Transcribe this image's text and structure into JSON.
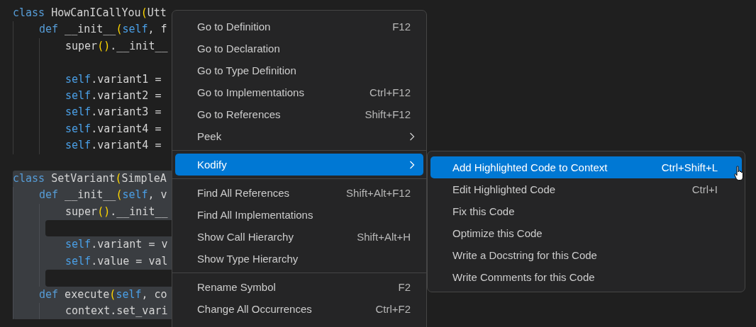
{
  "editor": {
    "blocks": [
      {
        "selected": false,
        "tokens": [
          {
            "text": "class",
            "kind": "keyword"
          },
          {
            "text": " HowCanICallYou",
            "kind": "plain"
          },
          {
            "text": "(",
            "kind": "paren"
          },
          {
            "text": "Utt",
            "kind": "plain"
          }
        ],
        "children": [
          {
            "tokens": [
              {
                "text": "def",
                "kind": "keyword"
              },
              {
                "text": " __init__",
                "kind": "plain"
              },
              {
                "text": "(",
                "kind": "paren"
              },
              {
                "text": "self",
                "kind": "self"
              },
              {
                "text": ", f",
                "kind": "plain"
              }
            ],
            "children": [
              {
                "tokens": [
                  {
                    "text": "super",
                    "kind": "plain"
                  },
                  {
                    "text": "()",
                    "kind": "paren"
                  },
                  {
                    "text": ".__init__",
                    "kind": "plain"
                  }
                ]
              },
              {
                "kind": "blank"
              },
              {
                "tokens": [
                  {
                    "text": "self",
                    "kind": "self"
                  },
                  {
                    "text": ".variant1 =",
                    "kind": "plain"
                  }
                ]
              },
              {
                "tokens": [
                  {
                    "text": "self",
                    "kind": "self"
                  },
                  {
                    "text": ".variant2 =",
                    "kind": "plain"
                  }
                ]
              },
              {
                "tokens": [
                  {
                    "text": "self",
                    "kind": "self"
                  },
                  {
                    "text": ".variant3 =",
                    "kind": "plain"
                  }
                ]
              },
              {
                "tokens": [
                  {
                    "text": "self",
                    "kind": "self"
                  },
                  {
                    "text": ".variant4 =",
                    "kind": "plain"
                  }
                ]
              },
              {
                "tokens": [
                  {
                    "text": "self",
                    "kind": "self"
                  },
                  {
                    "text": ".variant4 =",
                    "kind": "plain"
                  }
                ]
              }
            ]
          }
        ]
      },
      {
        "selected": true,
        "tokens": [
          {
            "text": "class",
            "kind": "keyword"
          },
          {
            "text": " SetVariant",
            "kind": "plain"
          },
          {
            "text": "(",
            "kind": "paren"
          },
          {
            "text": "SimpleA",
            "kind": "plain"
          }
        ],
        "children": [
          {
            "tokens": [
              {
                "text": "def",
                "kind": "keyword"
              },
              {
                "text": " __init__",
                "kind": "plain"
              },
              {
                "text": "(",
                "kind": "paren"
              },
              {
                "text": "self",
                "kind": "self"
              },
              {
                "text": ", v",
                "kind": "plain"
              }
            ],
            "children": [
              {
                "tokens": [
                  {
                    "text": "super",
                    "kind": "plain"
                  },
                  {
                    "text": "()",
                    "kind": "paren"
                  },
                  {
                    "text": ".__init__",
                    "kind": "plain"
                  }
                ]
              },
              {
                "kind": "blank"
              },
              {
                "tokens": [
                  {
                    "text": "self",
                    "kind": "self"
                  },
                  {
                    "text": ".variant = v",
                    "kind": "plain"
                  }
                ]
              },
              {
                "tokens": [
                  {
                    "text": "self",
                    "kind": "self"
                  },
                  {
                    "text": ".value = val",
                    "kind": "plain"
                  }
                ]
              },
              {
                "kind": "blank"
              }
            ]
          },
          {
            "tokens": [
              {
                "text": "def",
                "kind": "keyword"
              },
              {
                "text": " execute",
                "kind": "plain"
              },
              {
                "text": "(",
                "kind": "paren"
              },
              {
                "text": "self",
                "kind": "self"
              },
              {
                "text": ", co",
                "kind": "plain"
              }
            ],
            "children": [
              {
                "tokens": [
                  {
                    "text": "context.set_vari",
                    "kind": "plain"
                  }
                ]
              }
            ]
          }
        ]
      }
    ]
  },
  "context_menu": {
    "groups": [
      {
        "items": [
          {
            "label": "Go to Definition",
            "shortcut": "F12",
            "has_submenu": false,
            "selected": false
          },
          {
            "label": "Go to Declaration",
            "has_submenu": false,
            "selected": false
          },
          {
            "label": "Go to Type Definition",
            "has_submenu": false,
            "selected": false
          },
          {
            "label": "Go to Implementations",
            "shortcut": "Ctrl+F12",
            "has_submenu": false,
            "selected": false
          },
          {
            "label": "Go to References",
            "shortcut": "Shift+F12",
            "has_submenu": false,
            "selected": false
          },
          {
            "label": "Peek",
            "has_submenu": true,
            "selected": false
          }
        ]
      },
      {
        "items": [
          {
            "label": "Kodify",
            "has_submenu": true,
            "selected": true
          }
        ]
      },
      {
        "items": [
          {
            "label": "Find All References",
            "shortcut": "Shift+Alt+F12",
            "has_submenu": false,
            "selected": false
          },
          {
            "label": "Find All Implementations",
            "has_submenu": false,
            "selected": false
          },
          {
            "label": "Show Call Hierarchy",
            "shortcut": "Shift+Alt+H",
            "has_submenu": false,
            "selected": false
          },
          {
            "label": "Show Type Hierarchy",
            "has_submenu": false,
            "selected": false
          }
        ]
      },
      {
        "items": [
          {
            "label": "Rename Symbol",
            "shortcut": "F2",
            "has_submenu": false,
            "selected": false
          },
          {
            "label": "Change All Occurrences",
            "shortcut": "Ctrl+F2",
            "has_submenu": false,
            "selected": false
          }
        ]
      }
    ]
  },
  "submenu": {
    "items": [
      {
        "label": "Add Highlighted Code to Context",
        "shortcut": "Ctrl+Shift+L",
        "selected": true
      },
      {
        "label": "Edit Highlighted Code",
        "shortcut": "Ctrl+I",
        "selected": false
      },
      {
        "label": "Fix this Code",
        "selected": false
      },
      {
        "label": "Optimize this Code",
        "selected": false
      },
      {
        "label": "Write a Docstring for this Code",
        "selected": false
      },
      {
        "label": "Write Comments for this Code",
        "selected": false
      }
    ]
  }
}
